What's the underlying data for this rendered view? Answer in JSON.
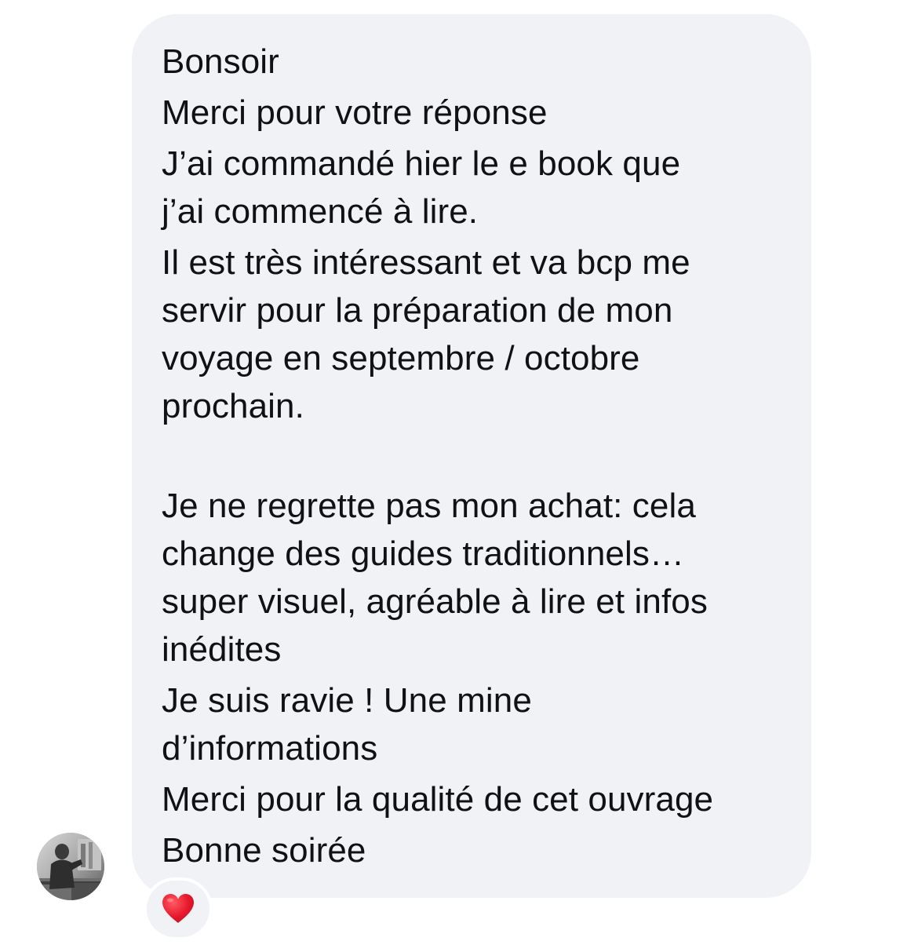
{
  "message": {
    "lines": [
      "Bonsoir",
      "Merci pour votre réponse",
      "J’ai commandé hier le e book que",
      "j’ai commencé à lire.",
      "Il est très intéressant et va bcp me",
      "servir pour la préparation de mon",
      "voyage en septembre / octobre",
      "prochain.",
      "Je ne regrette pas mon achat: cela",
      "change des guides traditionnels…",
      "super visuel, agréable à lire et infos",
      "inédites",
      "Je suis ravie ! Une mine",
      "d’informations",
      "Merci pour la qualité de cet ouvrage",
      "Bonne soirée"
    ]
  },
  "sender": {
    "avatar_icon": "avatar-photo"
  },
  "reaction": {
    "icon": "red-heart-icon",
    "color": "#e8192c"
  },
  "colors": {
    "bubble": "#f1f2f5",
    "text": "#101114",
    "background": "#ffffff"
  }
}
